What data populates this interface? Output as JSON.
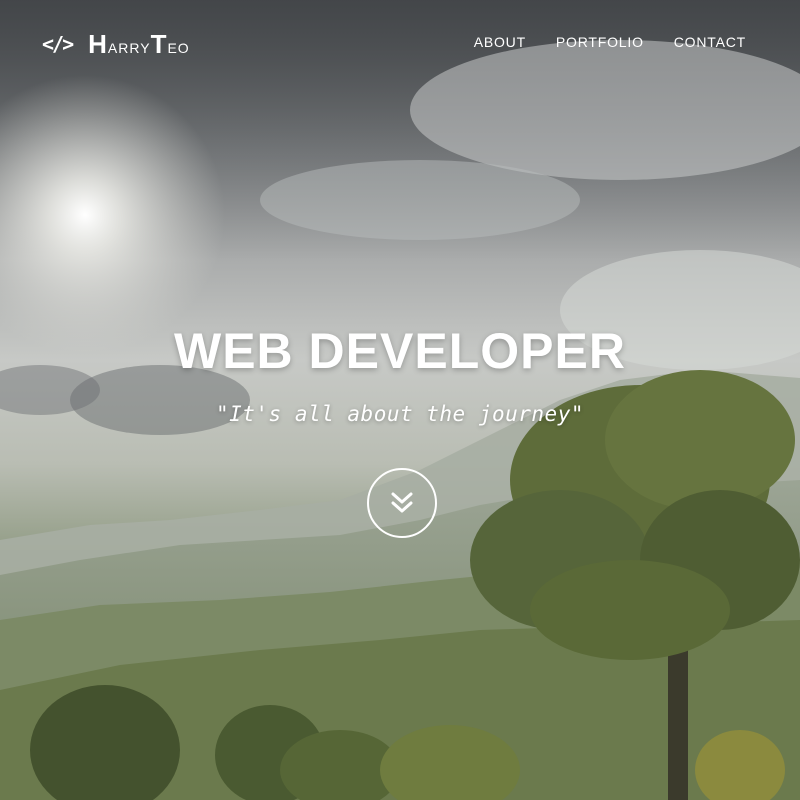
{
  "brand": {
    "icon": "code-icon",
    "icon_glyph": "</>",
    "name_part1_initial": "H",
    "name_part1_rest": "arry",
    "name_part2_initial": "T",
    "name_part2_rest": "eo"
  },
  "nav": {
    "items": [
      {
        "label": "ABOUT"
      },
      {
        "label": "PORTFOLIO"
      },
      {
        "label": "CONTACT"
      }
    ]
  },
  "hero": {
    "title": "WEB DEVELOPER",
    "subtitle": "\"It's all about the journey\"",
    "scroll_icon": "double-chevron-down-icon"
  },
  "colors": {
    "text": "#ffffff",
    "sky": "#a9abab",
    "foliage": "#55643e"
  }
}
